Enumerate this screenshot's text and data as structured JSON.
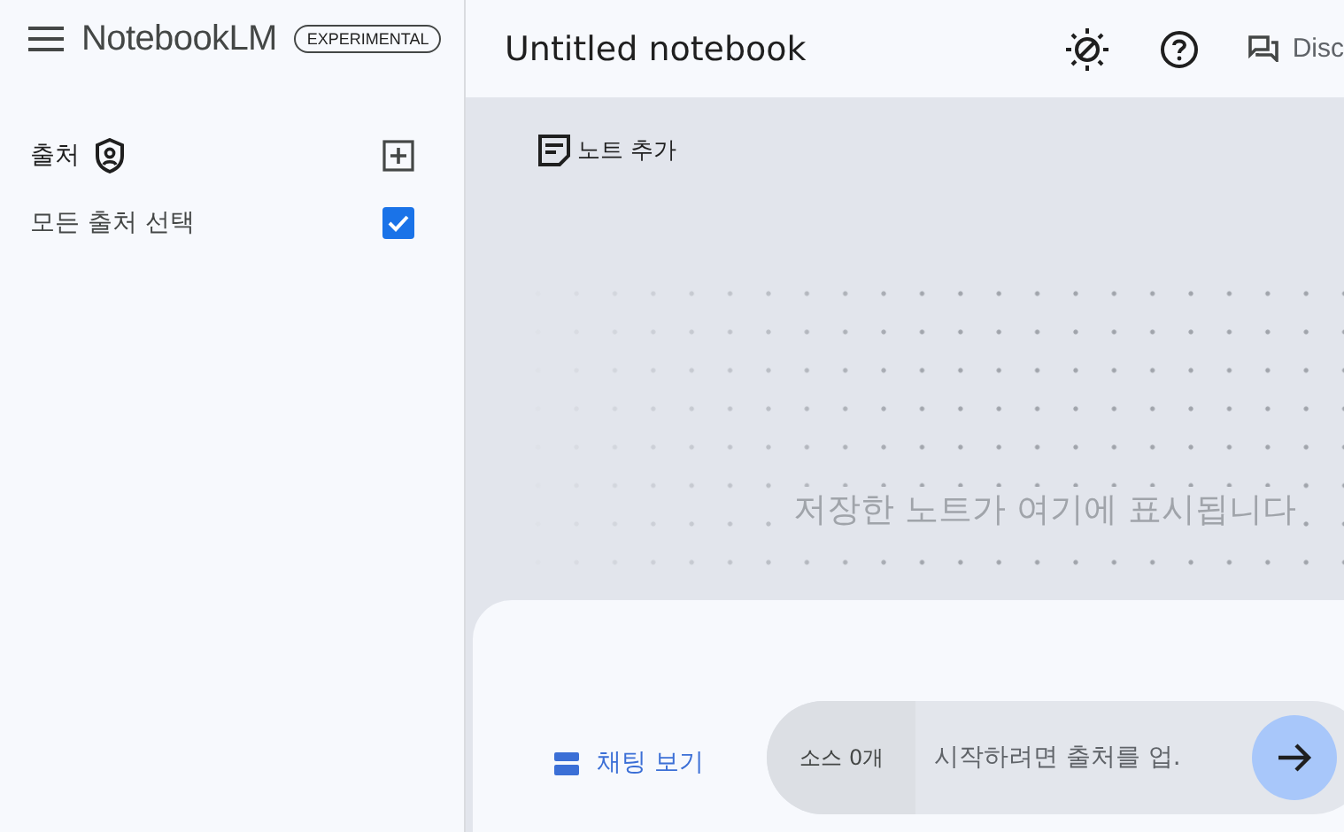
{
  "app": {
    "name": "NotebookLM",
    "badge": "EXPERIMENTAL"
  },
  "sidebar": {
    "title": "출처",
    "select_all": {
      "label": "모든 출처 선택",
      "checked": true
    }
  },
  "header": {
    "title": "Untitled notebook",
    "discord_label": "Disc"
  },
  "notes": {
    "add_button": "노트 추가",
    "empty_message": "저장한 노트가 여기에 표시됩니다"
  },
  "chat": {
    "view_button": "채팅 보기",
    "source_count": "소스 0개",
    "placeholder": "시작하려면 출처를 업."
  }
}
